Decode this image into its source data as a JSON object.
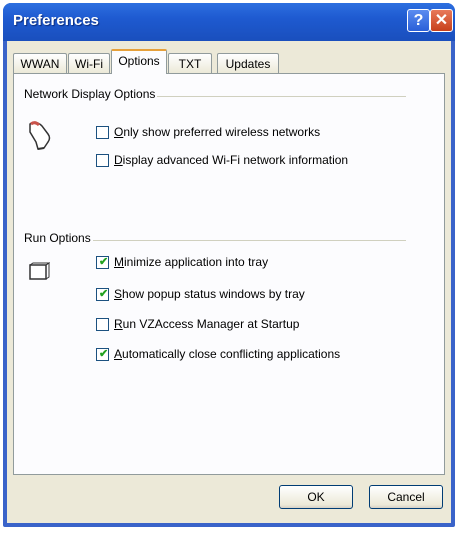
{
  "window": {
    "title": "Preferences",
    "help_glyph": "?",
    "close_glyph": "✕"
  },
  "tabs": [
    {
      "label": "WWAN"
    },
    {
      "label": "Wi-Fi"
    },
    {
      "label": "Options",
      "active": true
    },
    {
      "label": "TXT"
    },
    {
      "label": "Updates"
    }
  ],
  "network_display": {
    "title": "Network Display Options",
    "icon": "hand-pointer-icon",
    "options": [
      {
        "mnemonic": "O",
        "rest": "nly show preferred wireless networks",
        "checked": false
      },
      {
        "mnemonic": "D",
        "rest": "isplay advanced Wi-Fi network information",
        "checked": false
      }
    ]
  },
  "run_options": {
    "title": "Run Options",
    "icon": "window-frame-icon",
    "options": [
      {
        "mnemonic": "M",
        "rest": "inimize application into tray",
        "checked": true
      },
      {
        "mnemonic": "S",
        "rest": "how popup status windows by tray",
        "checked": true
      },
      {
        "mnemonic": "R",
        "rest": "un VZAccess Manager at Startup",
        "checked": false
      },
      {
        "mnemonic": "A",
        "rest": "utomatically close conflicting applications",
        "checked": true
      }
    ]
  },
  "buttons": {
    "ok": "OK",
    "cancel": "Cancel"
  },
  "check_glyph": "✔"
}
